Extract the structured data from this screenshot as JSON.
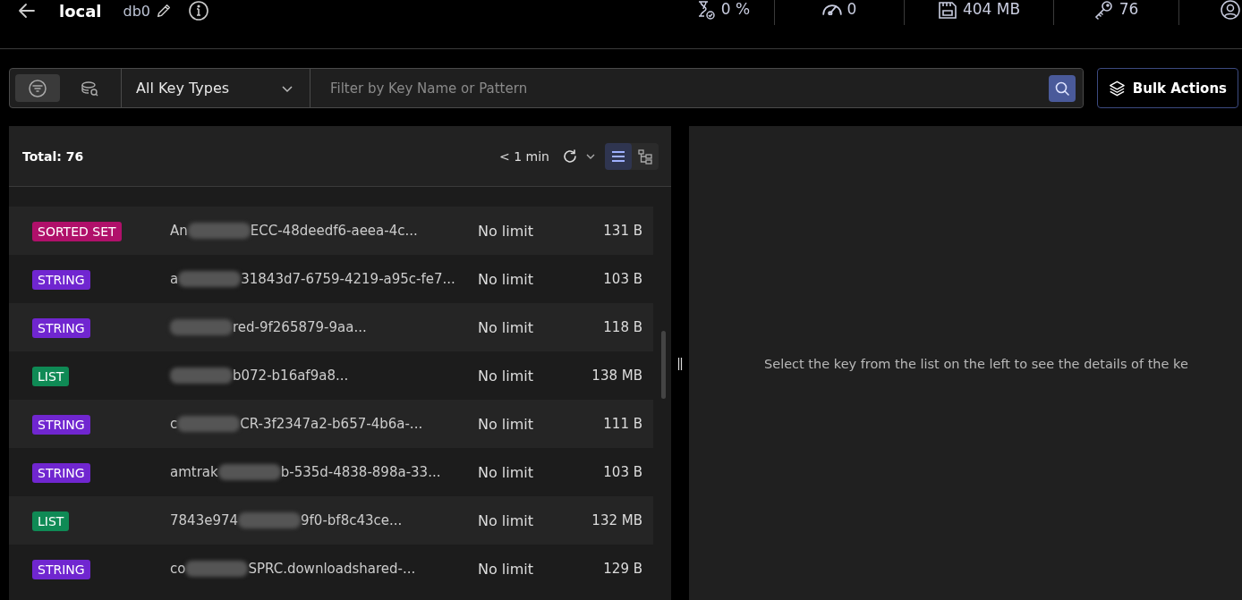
{
  "header": {
    "db_alias": "local",
    "db_index": "db0",
    "stats": [
      {
        "kind": "cpu",
        "value": "0 %"
      },
      {
        "kind": "ops",
        "value": "0"
      },
      {
        "kind": "memory",
        "value": "404 MB"
      },
      {
        "kind": "keys",
        "value": "76"
      }
    ]
  },
  "toolbar": {
    "modes": [
      {
        "kind": "filter",
        "selected": true
      },
      {
        "kind": "search",
        "selected": false
      }
    ],
    "key_type": "All Key Types",
    "search": {
      "placeholder": "Filter by Key Name or Pattern"
    },
    "bulk_button": "Bulk Actions"
  },
  "key_list": {
    "total": "Total: 76",
    "refresh": "< 1 min",
    "views": [
      {
        "kind": "list",
        "selected": true
      },
      {
        "kind": "tree",
        "selected": false
      }
    ],
    "rows": [
      {
        "type": "SORTED SET",
        "color": "#b0106a",
        "name_start": "An",
        "redacted": true,
        "name_end": "ECC-48deedf6-aeea-4c...",
        "ttl": "No limit",
        "size": "131 B"
      },
      {
        "type": "STRING",
        "color": "#7026d0",
        "name_start": "a",
        "redacted": true,
        "name_end": "31843d7-6759-4219-a95c-fe7...",
        "ttl": "No limit",
        "size": "103 B"
      },
      {
        "type": "STRING",
        "color": "#7026d0",
        "name_start": "",
        "redacted": true,
        "name_end": "red-9f265879-9aa...",
        "ttl": "No limit",
        "size": "118 B"
      },
      {
        "type": "LIST",
        "color": "#0f8a55",
        "name_start": "",
        "redacted": true,
        "name_end": "b072-b16af9a8...",
        "ttl": "No limit",
        "size": "138 MB"
      },
      {
        "type": "STRING",
        "color": "#7026d0",
        "name_start": "c",
        "redacted": true,
        "name_end": "CR-3f2347a2-b657-4b6a-...",
        "ttl": "No limit",
        "size": "111 B"
      },
      {
        "type": "STRING",
        "color": "#7026d0",
        "name_start": "amtrak",
        "redacted": true,
        "name_end": "b-535d-4838-898a-33...",
        "ttl": "No limit",
        "size": "103 B"
      },
      {
        "type": "LIST",
        "color": "#0f8a55",
        "name_start": "7843e974",
        "redacted": true,
        "name_end": "9f0-bf8c43ce...",
        "ttl": "No limit",
        "size": "132 MB"
      },
      {
        "type": "STRING",
        "color": "#7026d0",
        "name_start": "co",
        "redacted": true,
        "name_end": "SPRC.downloadshared-...",
        "ttl": "No limit",
        "size": "129 B"
      }
    ]
  },
  "details": {
    "empty_message": "Select the key from the list on the left to see the details of the ke"
  }
}
